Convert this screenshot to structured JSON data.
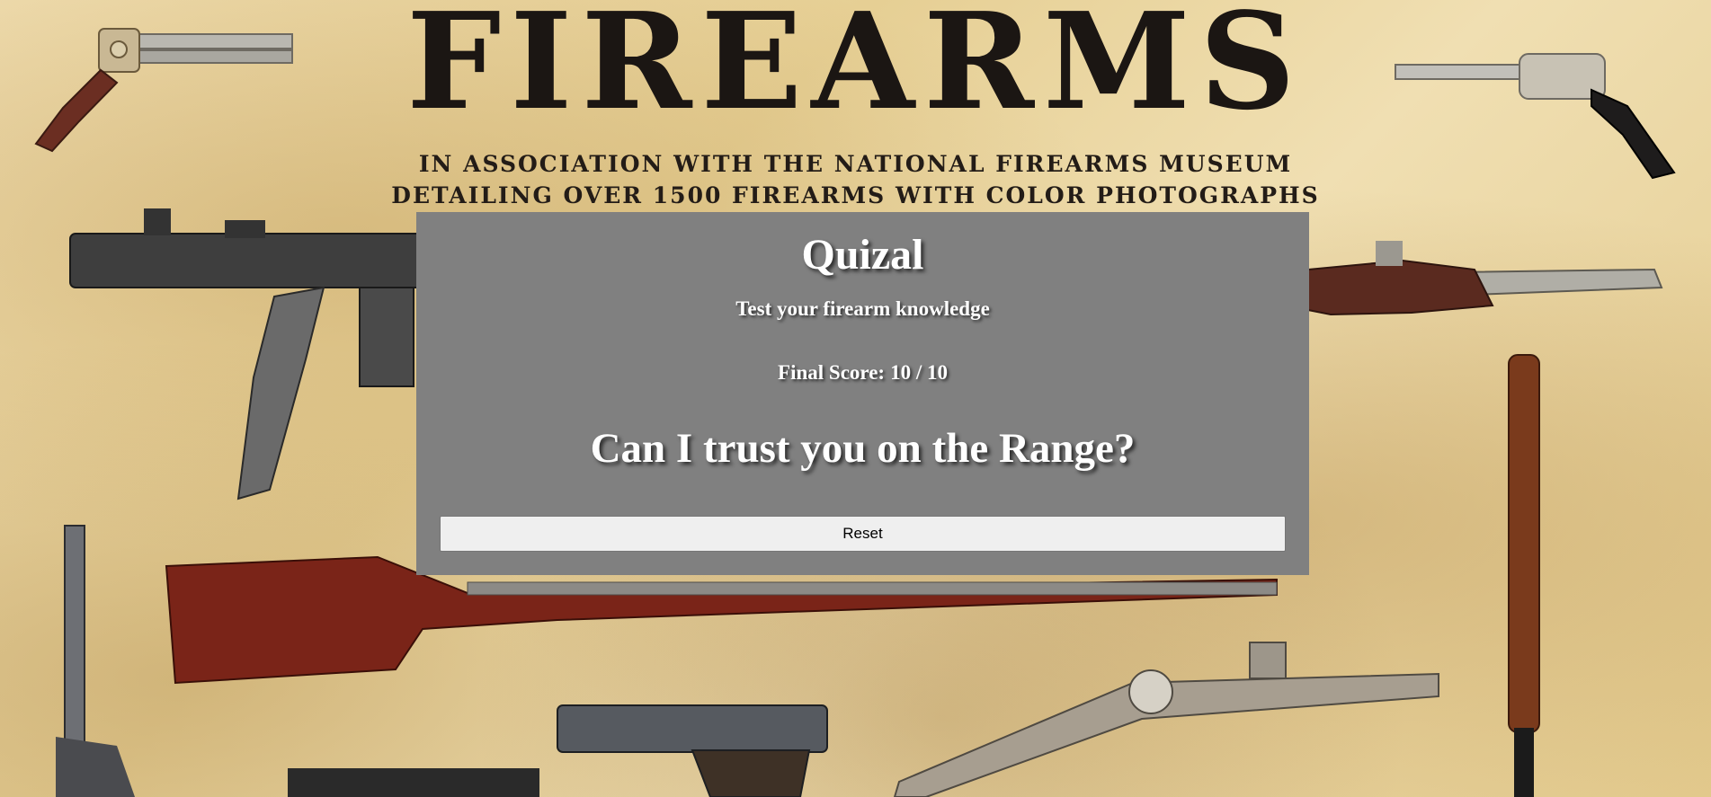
{
  "poster": {
    "title": "FIREARMS",
    "subtitle_line1": "IN ASSOCIATION WITH THE NATIONAL FIREARMS MUSEUM",
    "subtitle_line2": "DETAILING OVER 1500 FIREARMS WITH COLOR PHOTOGRAPHS"
  },
  "quiz": {
    "title": "Quizal",
    "tagline": "Test your firearm knowledge",
    "score_label": "Final Score:",
    "score_value": "10 / 10",
    "verdict": "Can I trust you on the Range?",
    "reset_label": "Reset"
  },
  "icons": [
    "derringer-pistol-icon",
    "revolver-icon",
    "submachine-gun-icon",
    "flintlock-pistol-icon",
    "rifle-icon",
    "semi-auto-pistol-icon",
    "wheellock-pistol-icon",
    "rod-icon"
  ],
  "colors": {
    "panel_bg": "#808080",
    "panel_text": "#ffffff",
    "button_bg": "#efefef",
    "poster_ink": "#1b1613",
    "parchment": "#ecd8a4"
  }
}
